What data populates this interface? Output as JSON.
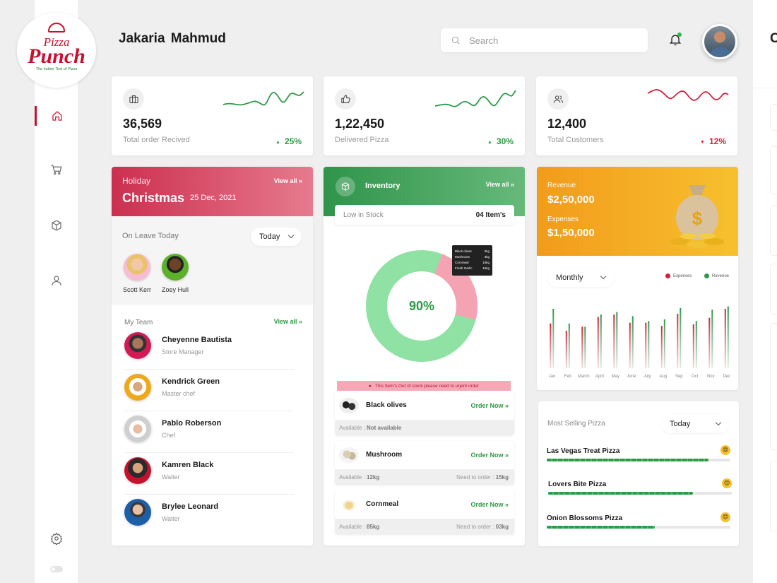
{
  "brand": {
    "line1": "Pizza",
    "line2": "Punch",
    "tagline": "The Indian Test of Pizza"
  },
  "header": {
    "username": "Jakaria  Mahmud",
    "search_placeholder": "Search",
    "right_title": "C"
  },
  "stats": [
    {
      "value": "36,569",
      "label": "Total order Recived",
      "change": "25%",
      "trend": "up",
      "spark_color": "#2d9a47",
      "icon": "briefcase-icon"
    },
    {
      "value": "1,22,450",
      "label": "Delivered Pizza",
      "change": "30%",
      "trend": "up",
      "spark_color": "#2d9a47",
      "icon": "thumbs-up-icon"
    },
    {
      "value": "12,400",
      "label": "Total Customers",
      "change": "12%",
      "trend": "down",
      "spark_color": "#d21f3c",
      "icon": "users-icon"
    }
  ],
  "holiday": {
    "label": "Holiday",
    "name": "Christmas",
    "date": "25 Dec, 2021",
    "view_all": "View all"
  },
  "leave": {
    "title": "On Leave Today",
    "filter": "Today",
    "people": [
      "Scott Kerr",
      "Zoey Hull"
    ]
  },
  "team": {
    "title": "My Team",
    "view_all": "View all",
    "members": [
      {
        "name": "Cheyenne Bautista",
        "role": "Store Manager"
      },
      {
        "name": "Kendrick Green",
        "role": "Master chef"
      },
      {
        "name": "Pablo Roberson",
        "role": "Chef"
      },
      {
        "name": "Kamren Black",
        "role": "Waiter"
      },
      {
        "name": "Brylee Leonard",
        "role": "Waiter"
      }
    ]
  },
  "inventory": {
    "title": "Inventory",
    "view_all": "View all",
    "low_label": "Low in Stock",
    "low_count": "04 Item's",
    "percent_label": "90%",
    "stock_percent": 90,
    "tooltip": [
      {
        "name": "Black olives",
        "qty": "0kg"
      },
      {
        "name": "Mushroom",
        "qty": "3kg"
      },
      {
        "name": "Cornmeal",
        "qty": "15kg"
      },
      {
        "name": "Fresh Garlic",
        "qty": "15kg"
      }
    ],
    "warning": "This Item's Out of stock please need to urjent order",
    "items": [
      {
        "name": "Black olives",
        "order": "Order Now",
        "available_label": "Available :",
        "available": "Not available",
        "need_label": "",
        "need": ""
      },
      {
        "name": "Mushroom",
        "order": "Order Now",
        "available_label": "Available :",
        "available": "12kg",
        "need_label": "Need to order :",
        "need": "15kg"
      },
      {
        "name": "Cornmeal",
        "order": "Order Now",
        "available_label": "Available :",
        "available": "85kg",
        "need_label": "Need to order :",
        "need": "03kg"
      }
    ]
  },
  "revenue": {
    "revenue_label": "Revenue",
    "revenue_value": "$2,50,000",
    "expenses_label": "Expenses",
    "expenses_value": "$1,50,000",
    "filter": "Monthly",
    "legend_expenses": "Expenses",
    "legend_revenue": "Revenue",
    "colors": {
      "expenses": "#d21f3c",
      "revenue": "#2d9a47"
    }
  },
  "chart_data": {
    "type": "bar",
    "categories": [
      "Jan",
      "Feb",
      "March",
      "April",
      "May",
      "June",
      "July",
      "Aug",
      "Sep",
      "Oct",
      "Nov",
      "Dec"
    ],
    "series": [
      {
        "name": "Expenses",
        "values": [
          55,
          46,
          51,
          63,
          66,
          56,
          56,
          52,
          67,
          54,
          62,
          73
        ]
      },
      {
        "name": "Revenue",
        "values": [
          73,
          55,
          51,
          66,
          69,
          64,
          58,
          60,
          74,
          58,
          72,
          76
        ]
      }
    ],
    "ylim": [
      0,
      80
    ],
    "legend_position": "top-right",
    "grid": false
  },
  "selling": {
    "title": "Most Selling Pizza",
    "filter": "Today",
    "items": [
      {
        "name": "Las Vegas Treat Pizza",
        "progress": 0.88,
        "emoji": "😍"
      },
      {
        "name": "Lovers Bite Pizza",
        "progress": 0.79,
        "emoji": "😊"
      },
      {
        "name": "Onion Blossoms Pizza",
        "progress": 0.59,
        "emoji": "😊"
      }
    ]
  }
}
